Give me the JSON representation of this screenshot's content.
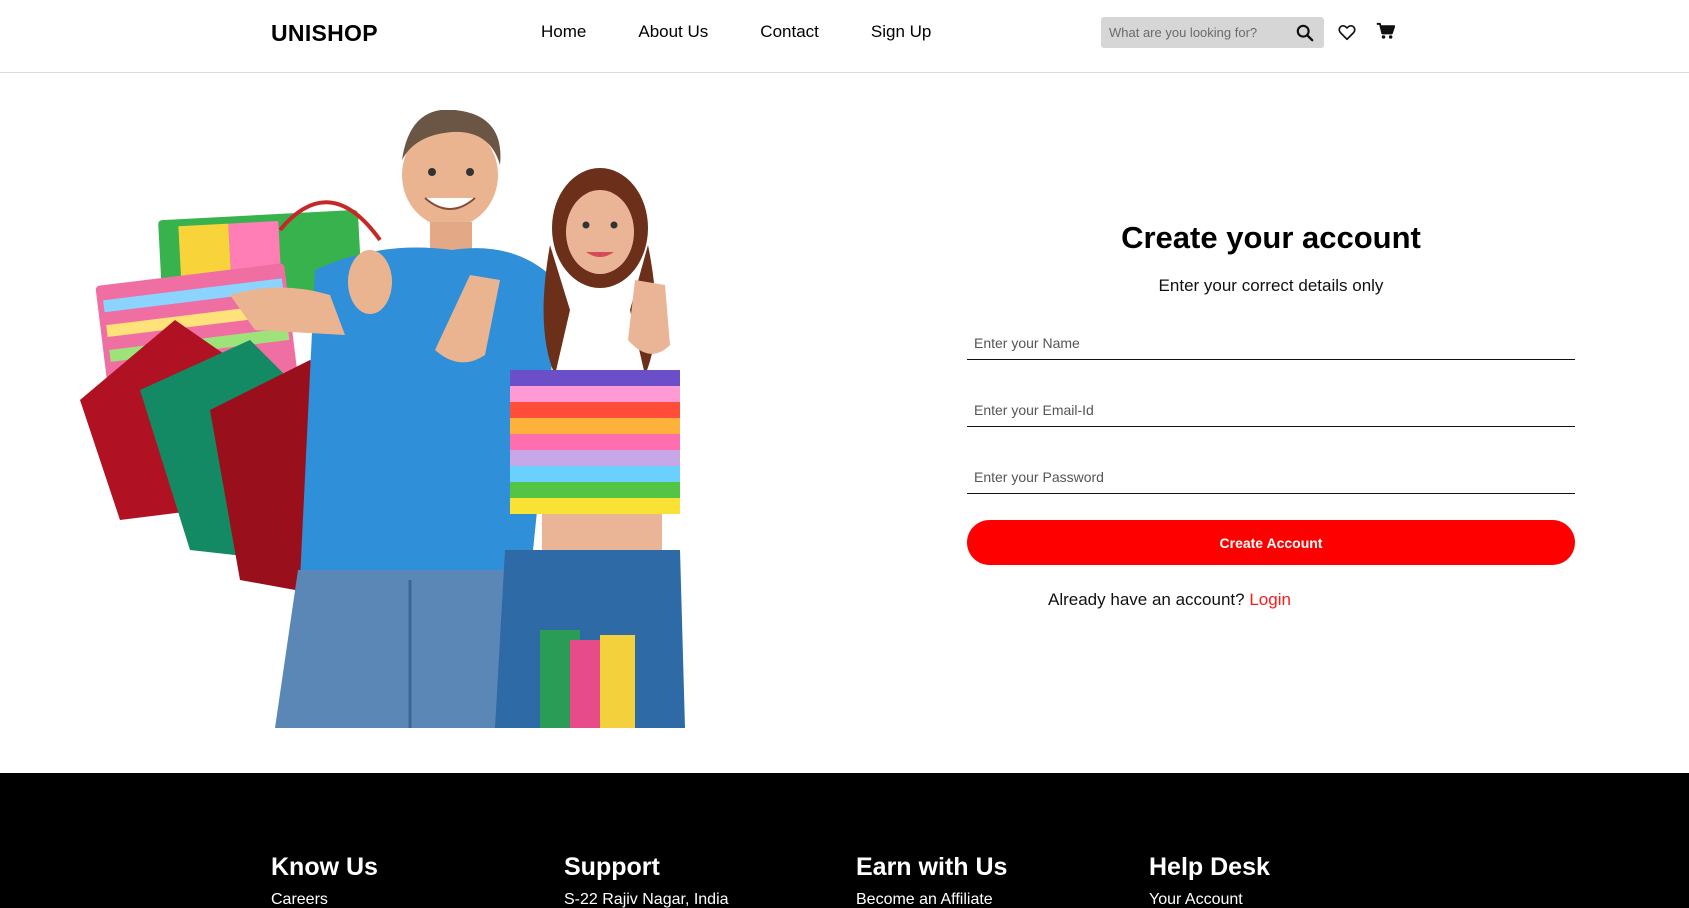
{
  "header": {
    "logo": "UNISHOP",
    "nav": [
      "Home",
      "About Us",
      "Contact",
      "Sign Up"
    ],
    "search_placeholder": "What are you looking for?"
  },
  "form": {
    "title": "Create your account",
    "subtitle": "Enter your correct details only",
    "name_placeholder": "Enter your Name",
    "email_placeholder": "Enter your Email-Id",
    "password_placeholder": "Enter your Password",
    "submit_label": "Create Account",
    "login_prompt": "Already have an account?",
    "login_link": "Login"
  },
  "footer": {
    "columns": [
      {
        "title": "Know Us",
        "link": "Careers"
      },
      {
        "title": "Support",
        "link": "S-22 Rajiv Nagar, India"
      },
      {
        "title": "Earn with Us",
        "link": "Become an Affiliate"
      },
      {
        "title": "Help Desk",
        "link": "Your Account"
      }
    ]
  },
  "colors": {
    "accent": "#ff0000",
    "footer_bg": "#000000",
    "search_bg": "#d6d6d6"
  },
  "icons": [
    "search-icon",
    "heart-icon",
    "cart-icon"
  ]
}
